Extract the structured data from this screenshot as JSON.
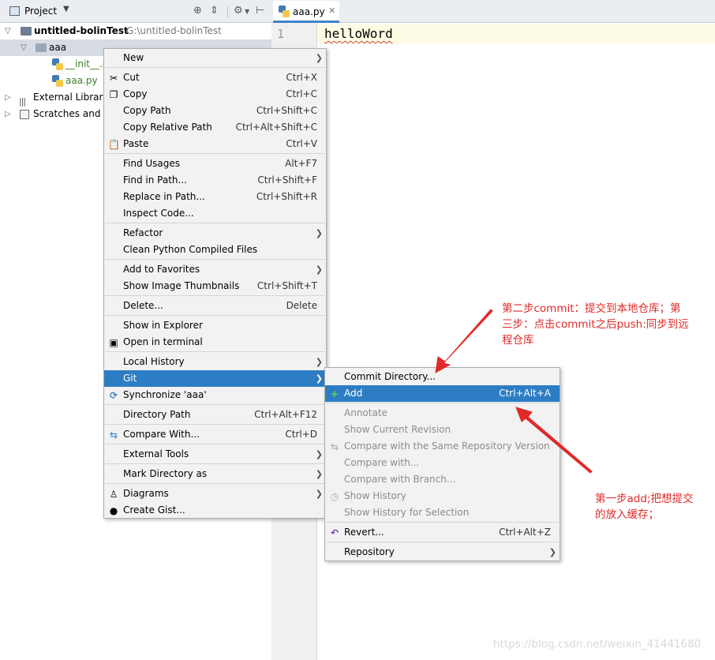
{
  "project_panel": {
    "title": "Project",
    "tree": {
      "root": {
        "name": "untitled-bolinTest",
        "path": "G:\\untitled-bolinTest"
      },
      "folder": "aaa",
      "files": [
        "__init__.py",
        "aaa.py"
      ],
      "external": "External Libraries",
      "scratches": "Scratches and Consoles"
    }
  },
  "editor": {
    "tab_label": "aaa.py",
    "line_number": "1",
    "code": "helloWord"
  },
  "context_menu": {
    "items": [
      {
        "label": "New",
        "shortcut": "",
        "submenu": true
      },
      {
        "label": "Cut",
        "shortcut": "Ctrl+X"
      },
      {
        "label": "Copy",
        "shortcut": "Ctrl+C"
      },
      {
        "label": "Copy Path",
        "shortcut": "Ctrl+Shift+C"
      },
      {
        "label": "Copy Relative Path",
        "shortcut": "Ctrl+Alt+Shift+C"
      },
      {
        "label": "Paste",
        "shortcut": "Ctrl+V"
      },
      {
        "label": "Find Usages",
        "shortcut": "Alt+F7"
      },
      {
        "label": "Find in Path...",
        "shortcut": "Ctrl+Shift+F"
      },
      {
        "label": "Replace in Path...",
        "shortcut": "Ctrl+Shift+R"
      },
      {
        "label": "Inspect Code...",
        "shortcut": ""
      },
      {
        "label": "Refactor",
        "shortcut": "",
        "submenu": true
      },
      {
        "label": "Clean Python Compiled Files",
        "shortcut": ""
      },
      {
        "label": "Add to Favorites",
        "shortcut": "",
        "submenu": true
      },
      {
        "label": "Show Image Thumbnails",
        "shortcut": "Ctrl+Shift+T"
      },
      {
        "label": "Delete...",
        "shortcut": "Delete"
      },
      {
        "label": "Show in Explorer",
        "shortcut": ""
      },
      {
        "label": "Open in terminal",
        "shortcut": ""
      },
      {
        "label": "Local History",
        "shortcut": "",
        "submenu": true
      },
      {
        "label": "Git",
        "shortcut": "",
        "submenu": true,
        "highlighted": true
      },
      {
        "label": "Synchronize 'aaa'",
        "shortcut": ""
      },
      {
        "label": "Directory Path",
        "shortcut": "Ctrl+Alt+F12"
      },
      {
        "label": "Compare With...",
        "shortcut": "Ctrl+D"
      },
      {
        "label": "External Tools",
        "shortcut": "",
        "submenu": true
      },
      {
        "label": "Mark Directory as",
        "shortcut": "",
        "submenu": true
      },
      {
        "label": "Diagrams",
        "shortcut": "",
        "submenu": true
      },
      {
        "label": "Create Gist...",
        "shortcut": ""
      }
    ]
  },
  "git_submenu": {
    "items": [
      {
        "label": "Commit Directory...",
        "shortcut": ""
      },
      {
        "label": "Add",
        "shortcut": "Ctrl+Alt+A",
        "highlighted": true
      },
      {
        "label": "Annotate",
        "shortcut": "",
        "disabled": true
      },
      {
        "label": "Show Current Revision",
        "shortcut": "",
        "disabled": true
      },
      {
        "label": "Compare with the Same Repository Version",
        "shortcut": "",
        "disabled": true
      },
      {
        "label": "Compare with...",
        "shortcut": "",
        "disabled": true
      },
      {
        "label": "Compare with Branch...",
        "shortcut": "",
        "disabled": true
      },
      {
        "label": "Show History",
        "shortcut": "",
        "disabled": true
      },
      {
        "label": "Show History for Selection",
        "shortcut": "",
        "disabled": true
      },
      {
        "label": "Revert...",
        "shortcut": "Ctrl+Alt+Z"
      },
      {
        "label": "Repository",
        "shortcut": "",
        "submenu": true
      }
    ]
  },
  "annotations": {
    "step2": [
      "第二步commit：提交到本地仓库；第",
      "三步：点击commit之后push:同步到远",
      "程仓库"
    ],
    "step1": [
      "第一步add;把想提交",
      "的放入缓存；"
    ],
    "color": "#e02a2a"
  },
  "watermark": "https://blog.csdn.net/weixin_41441680",
  "colors": {
    "highlight": "#2d7dc4",
    "menu_bg": "#f2f2f2",
    "arrow": "#e02a2a"
  }
}
